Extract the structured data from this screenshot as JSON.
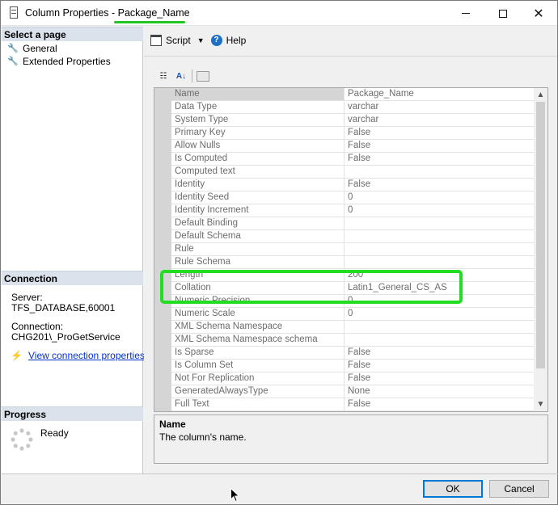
{
  "window": {
    "title": "Column Properties - Package_Name",
    "title_buttons": {
      "minimize_icon": "minimize-icon",
      "maximize_icon": "maximize-icon",
      "close_icon": "close-icon",
      "close_glyph": "✕"
    }
  },
  "left_pane": {
    "select_page_header": "Select a page",
    "pages": [
      {
        "label": "General",
        "icon": "wrench-icon"
      },
      {
        "label": "Extended Properties",
        "icon": "wrench-icon"
      }
    ],
    "connection_header": "Connection",
    "server_label": "Server:",
    "server_value": "TFS_DATABASE,60001",
    "connection_label": "Connection:",
    "connection_value": "CHG201\\_ProGetService",
    "view_connection_link": "View connection properties",
    "progress_header": "Progress",
    "progress_status": "Ready"
  },
  "toolbar": {
    "script_label": "Script",
    "help_label": "Help"
  },
  "property_grid": {
    "rows": [
      {
        "name": "Name",
        "value": "Package_Name",
        "selected": true
      },
      {
        "name": "Data Type",
        "value": "varchar"
      },
      {
        "name": "System Type",
        "value": "varchar"
      },
      {
        "name": "Primary Key",
        "value": "False"
      },
      {
        "name": "Allow Nulls",
        "value": "False"
      },
      {
        "name": "Is Computed",
        "value": "False"
      },
      {
        "name": "Computed text",
        "value": ""
      },
      {
        "name": "Identity",
        "value": "False"
      },
      {
        "name": "Identity Seed",
        "value": "0"
      },
      {
        "name": "Identity Increment",
        "value": "0"
      },
      {
        "name": "Default Binding",
        "value": ""
      },
      {
        "name": "Default Schema",
        "value": ""
      },
      {
        "name": "Rule",
        "value": ""
      },
      {
        "name": "Rule Schema",
        "value": ""
      },
      {
        "name": "Length",
        "value": "200"
      },
      {
        "name": "Collation",
        "value": "Latin1_General_CS_AS"
      },
      {
        "name": "Numeric Precision",
        "value": "0"
      },
      {
        "name": "Numeric Scale",
        "value": "0"
      },
      {
        "name": "XML Schema Namespace",
        "value": ""
      },
      {
        "name": "XML Schema Namespace schema",
        "value": ""
      },
      {
        "name": "Is Sparse",
        "value": "False"
      },
      {
        "name": "Is Column Set",
        "value": "False"
      },
      {
        "name": "Not For Replication",
        "value": "False"
      },
      {
        "name": "GeneratedAlwaysType",
        "value": "None"
      },
      {
        "name": "Full Text",
        "value": "False"
      }
    ]
  },
  "description": {
    "title": "Name",
    "text": "The column's name."
  },
  "buttons": {
    "ok": "OK",
    "cancel": "Cancel"
  },
  "colors": {
    "highlight": "#22dd22",
    "link": "#0033cc",
    "section_header": "#dbe2ec"
  }
}
